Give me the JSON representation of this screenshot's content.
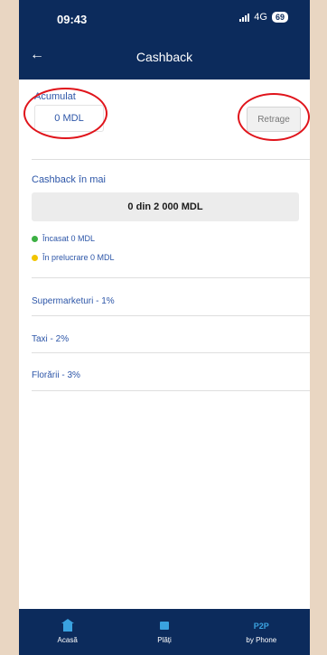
{
  "status": {
    "time": "09:43",
    "network": "4G",
    "battery": "69"
  },
  "header": {
    "title": "Cashback"
  },
  "accumulated": {
    "label": "Acumulat",
    "value": "0 MDL",
    "withdraw_label": "Retrage"
  },
  "month": {
    "title": "Cashback în mai",
    "progress": "0 din 2 000 MDL",
    "collected": "Încasat 0 MDL",
    "processing": "În prelucrare 0 MDL"
  },
  "categories": [
    "Supermarketuri - 1%",
    "Taxi - 2%",
    "Florării - 3%"
  ],
  "tabs": [
    {
      "label": "Acasă",
      "icon": "home-icon"
    },
    {
      "label": "Plăți",
      "icon": "wallet-icon"
    },
    {
      "label": "by Phone",
      "icon_text": "P2P"
    }
  ],
  "colors": {
    "header": "#0c2b5c",
    "accent": "#2d56a8",
    "collected": "#3cb043",
    "processing": "#f2c500",
    "annotation": "#e0141b"
  }
}
